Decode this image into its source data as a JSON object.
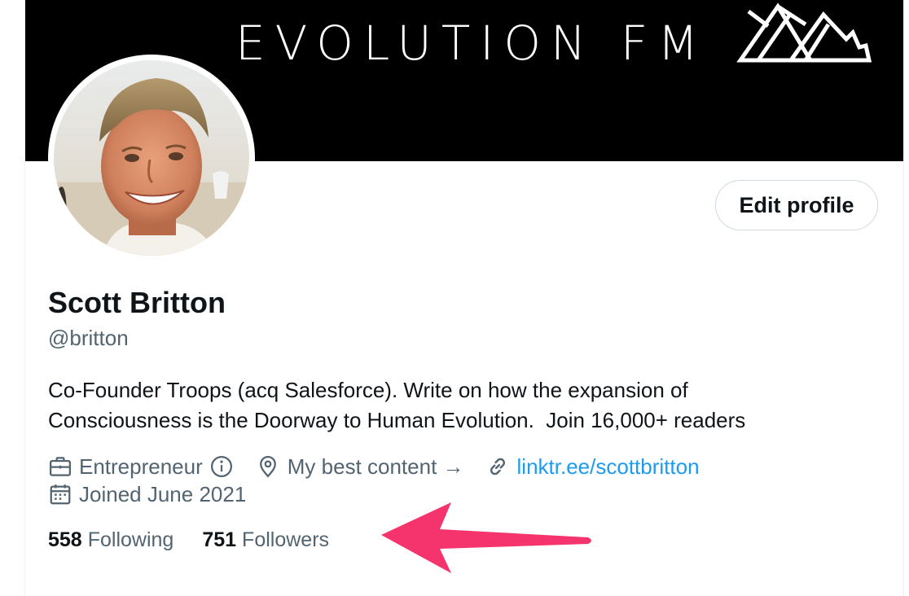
{
  "banner": {
    "title": "EVOLUTION FM",
    "background": "#000000"
  },
  "profile": {
    "name": "Scott Britton",
    "handle": "@britton",
    "edit_label": "Edit profile",
    "bio_lines": [
      "Co-Founder Troops (acq Salesforce). Write on how the expansion of",
      "Consciousness is the Doorway to Human Evolution.  Join 16,000+ readers"
    ],
    "meta": {
      "category": "Entrepreneur",
      "location": "My best content →",
      "link": "linktr.ee/scottbritton",
      "joined": "Joined June 2021"
    },
    "icons": {
      "category": "briefcase-icon",
      "info": "info-icon",
      "location": "location-pin-icon",
      "link": "link-icon",
      "joined": "calendar-icon"
    },
    "stats": {
      "following_count": "558",
      "following_label": "Following",
      "followers_count": "751",
      "followers_label": "Followers"
    }
  },
  "colors": {
    "text_primary": "#0f1419",
    "text_secondary": "#536471",
    "link": "#1d9bf0",
    "annotation_arrow": "#f5336c"
  }
}
